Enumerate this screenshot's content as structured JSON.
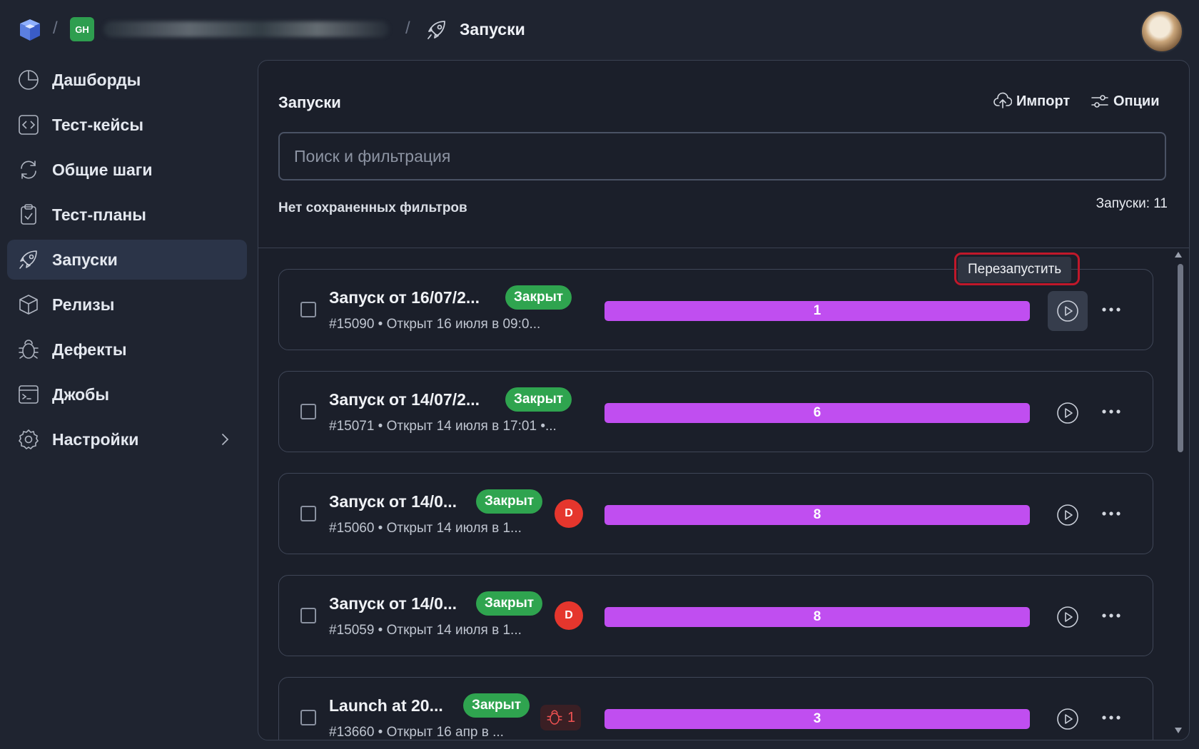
{
  "topbar": {
    "project_badge": "GH",
    "separator": "/",
    "page_title": "Запуски"
  },
  "sidebar": {
    "items": [
      {
        "label": "Дашборды",
        "icon": "pie-chart-icon"
      },
      {
        "label": "Тест-кейсы",
        "icon": "code-icon"
      },
      {
        "label": "Общие шаги",
        "icon": "refresh-icon"
      },
      {
        "label": "Тест-планы",
        "icon": "clipboard-check-icon"
      },
      {
        "label": "Запуски",
        "icon": "rocket-icon",
        "active": true
      },
      {
        "label": "Релизы",
        "icon": "package-icon"
      },
      {
        "label": "Дефекты",
        "icon": "bug-icon"
      },
      {
        "label": "Джобы",
        "icon": "terminal-icon"
      },
      {
        "label": "Настройки",
        "icon": "gear-icon",
        "has_submenu": true
      }
    ]
  },
  "panel": {
    "title": "Запуски",
    "import_label": "Импорт",
    "options_label": "Опции",
    "search_placeholder": "Поиск и фильтрация",
    "no_filters": "Нет сохраненных фильтров",
    "count": "Запуски: 11",
    "tooltip": "Перезапустить"
  },
  "launches": [
    {
      "title": "Запуск от 16/07/2...",
      "status": "Закрыт",
      "meta": "#15090 • Открыт 16 июля в 09:0...",
      "bar_value": "1",
      "user": "",
      "bugs": ""
    },
    {
      "title": "Запуск от 14/07/2...",
      "status": "Закрыт",
      "meta": "#15071 • Открыт 14 июля в 17:01 •...",
      "bar_value": "6",
      "user": "",
      "bugs": ""
    },
    {
      "title": "Запуск от 14/0...",
      "status": "Закрыт",
      "meta": "#15060 • Открыт 14 июля в 1...",
      "bar_value": "8",
      "user": "D",
      "bugs": ""
    },
    {
      "title": "Запуск от 14/0...",
      "status": "Закрыт",
      "meta": "#15059 • Открыт 14 июля в 1...",
      "bar_value": "8",
      "user": "D",
      "bugs": ""
    },
    {
      "title": "Launch at 20...",
      "status": "Закрыт",
      "meta": "#13660 • Открыт 16 апр в ...",
      "bar_value": "3",
      "user": "",
      "bugs": "1"
    }
  ],
  "colors": {
    "background": "#1f2430",
    "active_nav": "#2b3448",
    "closed_badge": "#2fa44f",
    "progress_bar": "#c04ef0",
    "user_avatar": "#e5362d",
    "highlight_outline": "#c0182a"
  }
}
